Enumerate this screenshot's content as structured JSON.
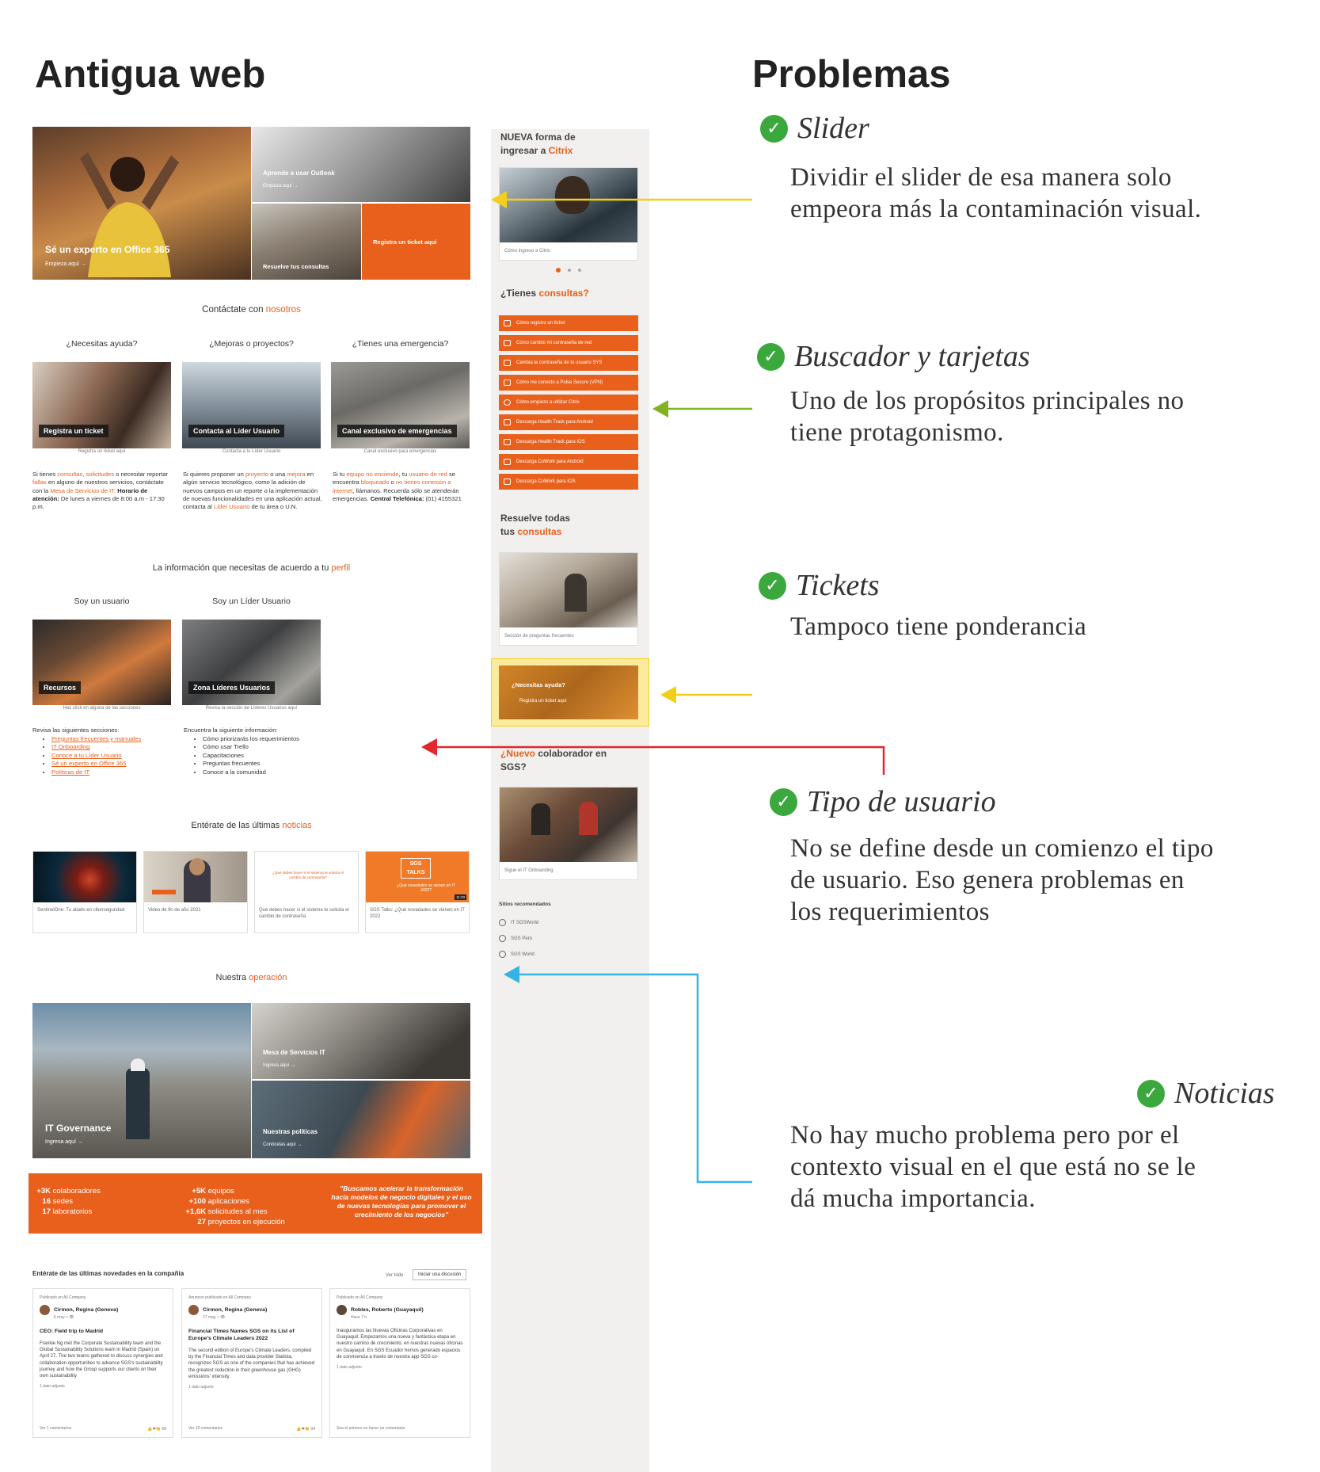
{
  "left": {
    "title": "Antigua web"
  },
  "right": {
    "title": "Problemas"
  },
  "hero": {
    "main": {
      "title": "Sé un experto en Office 365",
      "link": "Empieza aquí →"
    },
    "outlook": {
      "title": "Aprende a usar Outlook",
      "link": "Empieza aquí →"
    },
    "consultas": "Resuelve tus consultas",
    "ticket": "Registra un ticket aquí"
  },
  "contact": {
    "title_a": "Contáctate con ",
    "title_b": "nosotros",
    "cols": [
      {
        "title": "¿Necesitas ayuda?",
        "tag": "Registra un ticket",
        "caption": "Registra un ticket aquí",
        "p1": "Si tienes ",
        "l1": "consultas, solicitudes",
        "p2": " o necesitar reportar ",
        "l2": "fallas",
        "p3": " en alguno de nuestros servicios, contáctate con la ",
        "l3": "Mesa de Servicios de IT",
        "p4": ". ",
        "b1": "Horario de atención:",
        "p5": " De lunes a viernes de 8:00 a.m - 17:30 p.m."
      },
      {
        "title": "¿Mejoras o proyectos?",
        "tag": "Contacta al Líder Usuario",
        "caption": "Contacta a tu Líder Usuario",
        "p1": "Si quieres proponer un ",
        "l1": "proyecto",
        "p2": " o una ",
        "l2": "mejora",
        "p3": " en algún servicio tecnológico, como la adición de nuevos campos en un reporte o la implementación de nuevas funcionalidades en una aplicación actual, contacta al ",
        "l3": "Líder Usuario",
        "p4": " de tu área o U.N."
      },
      {
        "title": "¿Tienes una emergencia?",
        "tag": "Canal exclusivo de emergencias",
        "caption": "Canal exclusivo para emergencias",
        "p1": "Si tu ",
        "l1": "equipo no enciende",
        "p2": ", tu ",
        "l2": "usuario de red",
        "p3": " se encuentra ",
        "l3": "bloqueado",
        "p4": " o ",
        "l4": "no tienes conexión a internet",
        "p5": ", llámanos. Recuerda sólo se atenderán emergencias. ",
        "b1": "Central Telefónica:",
        "p6": " (01) 4155321"
      }
    ]
  },
  "profile": {
    "title_a": "La información que necesitas de acuerdo a tu ",
    "title_b": "perfil",
    "cols": [
      {
        "title": "Soy un usuario",
        "tag": "Recursos",
        "caption": "Haz click en alguna de las secciones",
        "intro": "Revisa las siguientes secciones:",
        "items": [
          "Preguntas frecuentes y manuales",
          "IT Onboarding",
          "Conoce a tu Líder Usuario",
          "Sé un experto en Office 365",
          "Políticas de IT"
        ]
      },
      {
        "title": "Soy un Líder Usuario",
        "tag": "Zona Líderes Usuarios",
        "caption": "Revisa la sección de Líderes Usuarios aquí",
        "intro": "Encuentra la siguiente información:",
        "items": [
          "Cómo priorizarás los requerimientos",
          "Cómo usar Trello",
          "Capacitaciones",
          "Preguntas frecuentes",
          "Conoce a la comunidad"
        ]
      }
    ]
  },
  "news": {
    "title_a": "Entérate de las últimas ",
    "title_b": "noticias",
    "items": [
      {
        "caption": "SentinelOne: Tu aliado en ciberseguridad"
      },
      {
        "caption": "Video de fin de año 2021"
      },
      {
        "caption": "Qué debes hacer si el sistema te solicita el cambio de contraseña",
        "overlay": "¿Qué debes hacer si el sistema te solicita el cambio de contraseña?"
      },
      {
        "caption": "SGS Talks: ¿Qué novedades se vienen en IT 2022",
        "badge": "SGS TALKS",
        "overlay": "¿Qué novedades se vienen en IT 2022?",
        "time": "11:33"
      }
    ]
  },
  "operation": {
    "title_a": "Nuestra ",
    "title_b": "operación",
    "gov": {
      "title": "IT Governance",
      "link": "Ingresa aquí →"
    },
    "mesa": {
      "title": "Mesa de Servicios IT",
      "link": "Ingresa aquí →"
    },
    "pol": {
      "title": "Nuestras políticas",
      "link": "Conócelas aquí →"
    }
  },
  "stats": {
    "col1": [
      {
        "n": "+3K",
        "t": "colaboradores"
      },
      {
        "n": "16",
        "t": "sedes"
      },
      {
        "n": "17",
        "t": "laboratorios"
      }
    ],
    "col2": [
      {
        "n": "+5K",
        "t": "equipos"
      },
      {
        "n": "+100",
        "t": "aplicaciones"
      },
      {
        "n": "+1,6K",
        "t": "solicitudes al mes"
      },
      {
        "n": "27",
        "t": "proyectos en ejecución"
      }
    ],
    "quote": "\"Buscamos acelerar la transformación hacia modelos de negocio digitales y el uso de nuevas tecnologías para promover el crecimiento de los negocios\""
  },
  "company": {
    "title": "Entérate de las últimas novedades en la compañía",
    "ver_todo": "Ver todo",
    "start": "Iniciar una discusión",
    "posts": [
      {
        "meta": "Publicado en All Company",
        "author": "Cirmon, Regina (Geneva)",
        "date": "6 may. • 👁",
        "title": "CEO: Field trip to Madrid",
        "body": "Frankie Ng met the Corporate Sustainability team and the Global Sustainability Solutions team in Madrid (Spain) on April 27. The two teams gathered to discuss synergies and collaboration opportunities to advance SGS's sustainability journey and how the Group supports our clients on their own sustainability",
        "attach": "1 dato adjunto",
        "comments": "Ver 1 comentarios",
        "likes": "👍❤👏 68"
      },
      {
        "meta": "Anunciar publicado en All Company",
        "author": "Cirmon, Regina (Geneva)",
        "date": "17 may. • 👁",
        "title": "Financial Times Names SGS on its List of Europe's Climate Leaders 2022",
        "body": "The second edition of Europe's Climate Leaders, compiled by the Financial Times and data provider Statista, recognizes SGS as one of the companies that has achieved the greatest reduction in their greenhouse gas (GHG) emissions' intensity.",
        "attach": "1 dato adjunto",
        "comments": "Ver 10 comentarios",
        "likes": "👍❤👏 94"
      },
      {
        "meta": "Publicado en All Company",
        "author": "Robles, Roberto (Guayaquil)",
        "date": "Hace 7 h",
        "title": "",
        "body": "Inauguramos las Nuevas Oficinas Corporativas en Guayaquil. Empezamos una nueva y fantástica etapa en nuestro camino de crecimiento, en nuestras nuevas oficinas en Guayaquil. En SGS Ecuador hemos generado espacios de convivencia a través de nuestra app SGS co-",
        "attach": "1 dato adjunto",
        "comments": "Sea el primero en hacer un comentario",
        "likes": ""
      }
    ]
  },
  "sidebar": {
    "citrix_a": "NUEVA forma de",
    "citrix_b": "ingresar a ",
    "citrix_c": "Citrix",
    "citrix_caption": "Cómo ingreso a Citrix",
    "consultas_a": "¿Tienes ",
    "consultas_b": "consultas?",
    "buttons": [
      "Cómo registro un ticket",
      "Cómo cambio mi contraseña de red",
      "Cambia la contraseña de tu usuario SYS",
      "Cómo me conecto a Pulse Secure (VPN)",
      "Cómo empiezo a utilizar Citrix",
      "Descarga Health Track para Android",
      "Descarga Health Track para IOS",
      "Descarga CoWork para Android",
      "Descarga CoWork para IOS"
    ],
    "resuelve_a": "Resuelve todas",
    "resuelve_b": "tus ",
    "resuelve_c": "consultas",
    "faq_caption": "Sección de preguntas frecuentes",
    "help_title": "¿Necesitas ayuda?",
    "help_link": "Registra un ticket aquí",
    "nuevo_a": "¿Nuevo",
    "nuevo_b": " colaborador en",
    "nuevo_c": "SGS?",
    "onboard_caption": "Sigue el IT Onboarding",
    "rec_title": "Sitios recomendados",
    "rec": [
      "IT SGSWorld",
      "SGS Perú",
      "SGS World"
    ]
  },
  "problems": [
    {
      "title": "Slider",
      "desc": [
        "Dividir el slider de esa manera solo",
        "empeora más la contaminación visual."
      ]
    },
    {
      "title": "Buscador y tarjetas",
      "desc": [
        "Uno de los propósitos principales no",
        "tiene protagonismo."
      ]
    },
    {
      "title": "Tickets",
      "desc": [
        "Tampoco tiene ponderancia"
      ]
    },
    {
      "title": "Tipo de usuario",
      "desc": [
        "No se define desde un comienzo el tipo",
        "de usuario. Eso genera problemas en",
        "los requerimientos"
      ]
    },
    {
      "title": "Noticias",
      "desc": [
        "No hay mucho problema pero por el",
        "contexto visual en el que está no se le",
        "dá mucha importancia."
      ]
    }
  ],
  "colors": {
    "accent": "#e8601c",
    "yellow": "#f2cf1d",
    "green": "#7fb321",
    "red": "#e0282d",
    "blue": "#35b3e5",
    "check": "#3aa83c"
  }
}
